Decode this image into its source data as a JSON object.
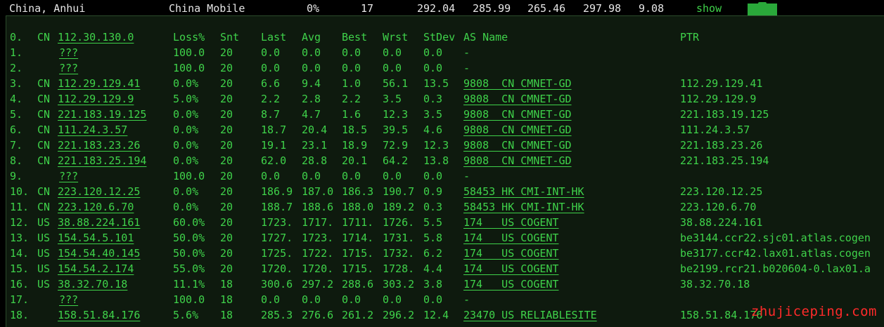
{
  "summary": {
    "location": "China, Anhui",
    "isp": "China Mobile",
    "loss": "0%",
    "sent": "17",
    "last": "292.04",
    "avg": "285.99",
    "best": "265.46",
    "worst": "297.98",
    "stdev": "9.08",
    "show_label": "show"
  },
  "table": {
    "headers": {
      "idx": "0.",
      "cc": "CN",
      "ip": "112.30.130.0",
      "loss": "Loss%",
      "snt": "Snt",
      "last": "Last",
      "avg": "Avg",
      "best": "Best",
      "wrst": "Wrst",
      "stdev": "StDev",
      "as_name": "AS Name",
      "ptr": "PTR"
    },
    "rows": [
      {
        "idx": "1.",
        "cc": "",
        "ip": "???",
        "loss": "100.0",
        "snt": "20",
        "last": "0.0",
        "avg": "0.0",
        "best": "0.0",
        "wrst": "0.0",
        "stdev": "0.0",
        "as": "-",
        "ptr": ""
      },
      {
        "idx": "2.",
        "cc": "",
        "ip": "???",
        "loss": "100.0",
        "snt": "20",
        "last": "0.0",
        "avg": "0.0",
        "best": "0.0",
        "wrst": "0.0",
        "stdev": "0.0",
        "as": "-",
        "ptr": ""
      },
      {
        "idx": "3.",
        "cc": "CN",
        "ip": "112.29.129.41",
        "loss": "0.0%",
        "snt": "20",
        "last": "6.6",
        "avg": "9.4",
        "best": "1.0",
        "wrst": "56.1",
        "stdev": "13.5",
        "as": "9808  CN CMNET-GD",
        "ptr": "112.29.129.41"
      },
      {
        "idx": "4.",
        "cc": "CN",
        "ip": "112.29.129.9",
        "loss": "5.0%",
        "snt": "20",
        "last": "2.2",
        "avg": "2.8",
        "best": "2.2",
        "wrst": "3.5",
        "stdev": "0.3",
        "as": "9808  CN CMNET-GD",
        "ptr": "112.29.129.9"
      },
      {
        "idx": "5.",
        "cc": "CN",
        "ip": "221.183.19.125",
        "loss": "0.0%",
        "snt": "20",
        "last": "8.7",
        "avg": "4.7",
        "best": "1.6",
        "wrst": "12.3",
        "stdev": "3.5",
        "as": "9808  CN CMNET-GD",
        "ptr": "221.183.19.125"
      },
      {
        "idx": "6.",
        "cc": "CN",
        "ip": "111.24.3.57",
        "loss": "0.0%",
        "snt": "20",
        "last": "18.7",
        "avg": "20.4",
        "best": "18.5",
        "wrst": "39.5",
        "stdev": "4.6",
        "as": "9808  CN CMNET-GD",
        "ptr": "111.24.3.57"
      },
      {
        "idx": "7.",
        "cc": "CN",
        "ip": "221.183.23.26",
        "loss": "0.0%",
        "snt": "20",
        "last": "19.1",
        "avg": "23.1",
        "best": "18.9",
        "wrst": "72.9",
        "stdev": "12.3",
        "as": "9808  CN CMNET-GD",
        "ptr": "221.183.23.26"
      },
      {
        "idx": "8.",
        "cc": "CN",
        "ip": "221.183.25.194",
        "loss": "0.0%",
        "snt": "20",
        "last": "62.0",
        "avg": "28.8",
        "best": "20.1",
        "wrst": "64.2",
        "stdev": "13.8",
        "as": "9808  CN CMNET-GD",
        "ptr": "221.183.25.194"
      },
      {
        "idx": "9.",
        "cc": "",
        "ip": "???",
        "loss": "100.0",
        "snt": "20",
        "last": "0.0",
        "avg": "0.0",
        "best": "0.0",
        "wrst": "0.0",
        "stdev": "0.0",
        "as": "-",
        "ptr": ""
      },
      {
        "idx": "10.",
        "cc": "CN",
        "ip": "223.120.12.25",
        "loss": "0.0%",
        "snt": "20",
        "last": "186.9",
        "avg": "187.0",
        "best": "186.3",
        "wrst": "190.7",
        "stdev": "0.9",
        "as": "58453 HK CMI-INT-HK",
        "ptr": "223.120.12.25"
      },
      {
        "idx": "11.",
        "cc": "CN",
        "ip": "223.120.6.70",
        "loss": "0.0%",
        "snt": "20",
        "last": "188.7",
        "avg": "188.6",
        "best": "188.0",
        "wrst": "189.2",
        "stdev": "0.3",
        "as": "58453 HK CMI-INT-HK",
        "ptr": "223.120.6.70"
      },
      {
        "idx": "12.",
        "cc": "US",
        "ip": "38.88.224.161",
        "loss": "60.0%",
        "snt": "20",
        "last": "1723.",
        "avg": "1717.",
        "best": "1711.",
        "wrst": "1726.",
        "stdev": "5.5",
        "as": "174   US COGENT",
        "ptr": "38.88.224.161"
      },
      {
        "idx": "13.",
        "cc": "US",
        "ip": "154.54.5.101",
        "loss": "50.0%",
        "snt": "20",
        "last": "1727.",
        "avg": "1723.",
        "best": "1714.",
        "wrst": "1731.",
        "stdev": "5.8",
        "as": "174   US COGENT",
        "ptr": "be3144.ccr22.sjc01.atlas.cogen"
      },
      {
        "idx": "14.",
        "cc": "US",
        "ip": "154.54.40.145",
        "loss": "50.0%",
        "snt": "20",
        "last": "1725.",
        "avg": "1722.",
        "best": "1715.",
        "wrst": "1732.",
        "stdev": "6.2",
        "as": "174   US COGENT",
        "ptr": "be3177.ccr42.lax01.atlas.cogen"
      },
      {
        "idx": "15.",
        "cc": "US",
        "ip": "154.54.2.174",
        "loss": "55.0%",
        "snt": "20",
        "last": "1720.",
        "avg": "1720.",
        "best": "1715.",
        "wrst": "1728.",
        "stdev": "4.4",
        "as": "174   US COGENT",
        "ptr": "be2199.rcr21.b020604-0.lax01.a"
      },
      {
        "idx": "16.",
        "cc": "US",
        "ip": "38.32.70.18",
        "loss": "11.1%",
        "snt": "18",
        "last": "300.6",
        "avg": "297.2",
        "best": "288.6",
        "wrst": "303.2",
        "stdev": "3.8",
        "as": "174   US COGENT",
        "ptr": "38.32.70.18"
      },
      {
        "idx": "17.",
        "cc": "",
        "ip": "???",
        "loss": "100.0",
        "snt": "18",
        "last": "0.0",
        "avg": "0.0",
        "best": "0.0",
        "wrst": "0.0",
        "stdev": "0.0",
        "as": "-",
        "ptr": ""
      },
      {
        "idx": "18.",
        "cc": "",
        "ip": "158.51.84.176",
        "loss": "5.6%",
        "snt": "18",
        "last": "285.3",
        "avg": "276.6",
        "best": "261.2",
        "wrst": "296.2",
        "stdev": "12.4",
        "as": "23470 US RELIABLESITE",
        "ptr": "158.51.84.176"
      }
    ]
  },
  "watermark": "zhujiceping.com",
  "colors": {
    "text_green": "#3fd24a",
    "panel_bg": "#0e1a0e",
    "header_text": "#e6e6e6",
    "watermark": "#ff2a2a"
  }
}
